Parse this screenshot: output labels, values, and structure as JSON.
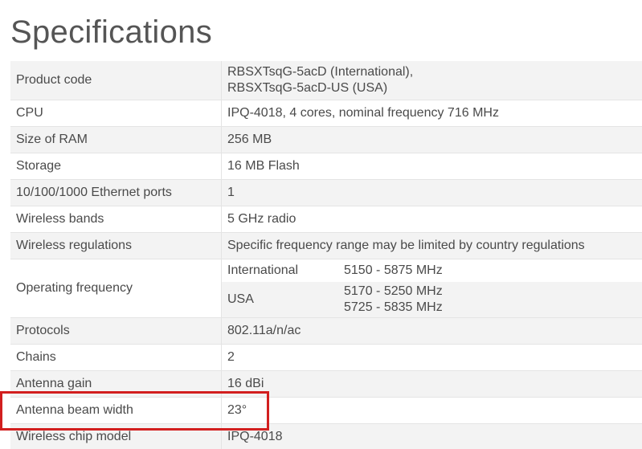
{
  "page": {
    "title": "Specifications"
  },
  "specs": {
    "rows": [
      {
        "label": "Product code",
        "value_line1": "RBSXTsqG-5acD (International),",
        "value_line2": "RBSXTsqG-5acD-US (USA)"
      },
      {
        "label": "CPU",
        "value": "IPQ-4018, 4 cores, nominal frequency 716 MHz"
      },
      {
        "label": "Size of RAM",
        "value": "256 MB"
      },
      {
        "label": "Storage",
        "value": "16 MB Flash"
      },
      {
        "label": "10/100/1000 Ethernet ports",
        "value": "1"
      },
      {
        "label": "Wireless bands",
        "value": "5 GHz radio"
      },
      {
        "label": "Wireless regulations",
        "value": "Specific frequency range may be limited by country regulations"
      },
      {
        "label": "Operating frequency",
        "regions": [
          {
            "region": "International",
            "range_line1": "5150 - 5875 MHz"
          },
          {
            "region": "USA",
            "range_line1": "5170 - 5250 MHz",
            "range_line2": "5725 - 5835 MHz"
          }
        ]
      },
      {
        "label": "Protocols",
        "value": "802.11a/n/ac"
      },
      {
        "label": "Chains",
        "value": "2"
      },
      {
        "label": "Antenna gain",
        "value": "16 dBi"
      },
      {
        "label": "Antenna beam width",
        "value": "23°"
      },
      {
        "label": "Wireless chip model",
        "value": "IPQ-4018"
      }
    ]
  },
  "annotation": {
    "highlight_color": "#d21f1f",
    "highlighted_row": "Antenna beam width"
  }
}
